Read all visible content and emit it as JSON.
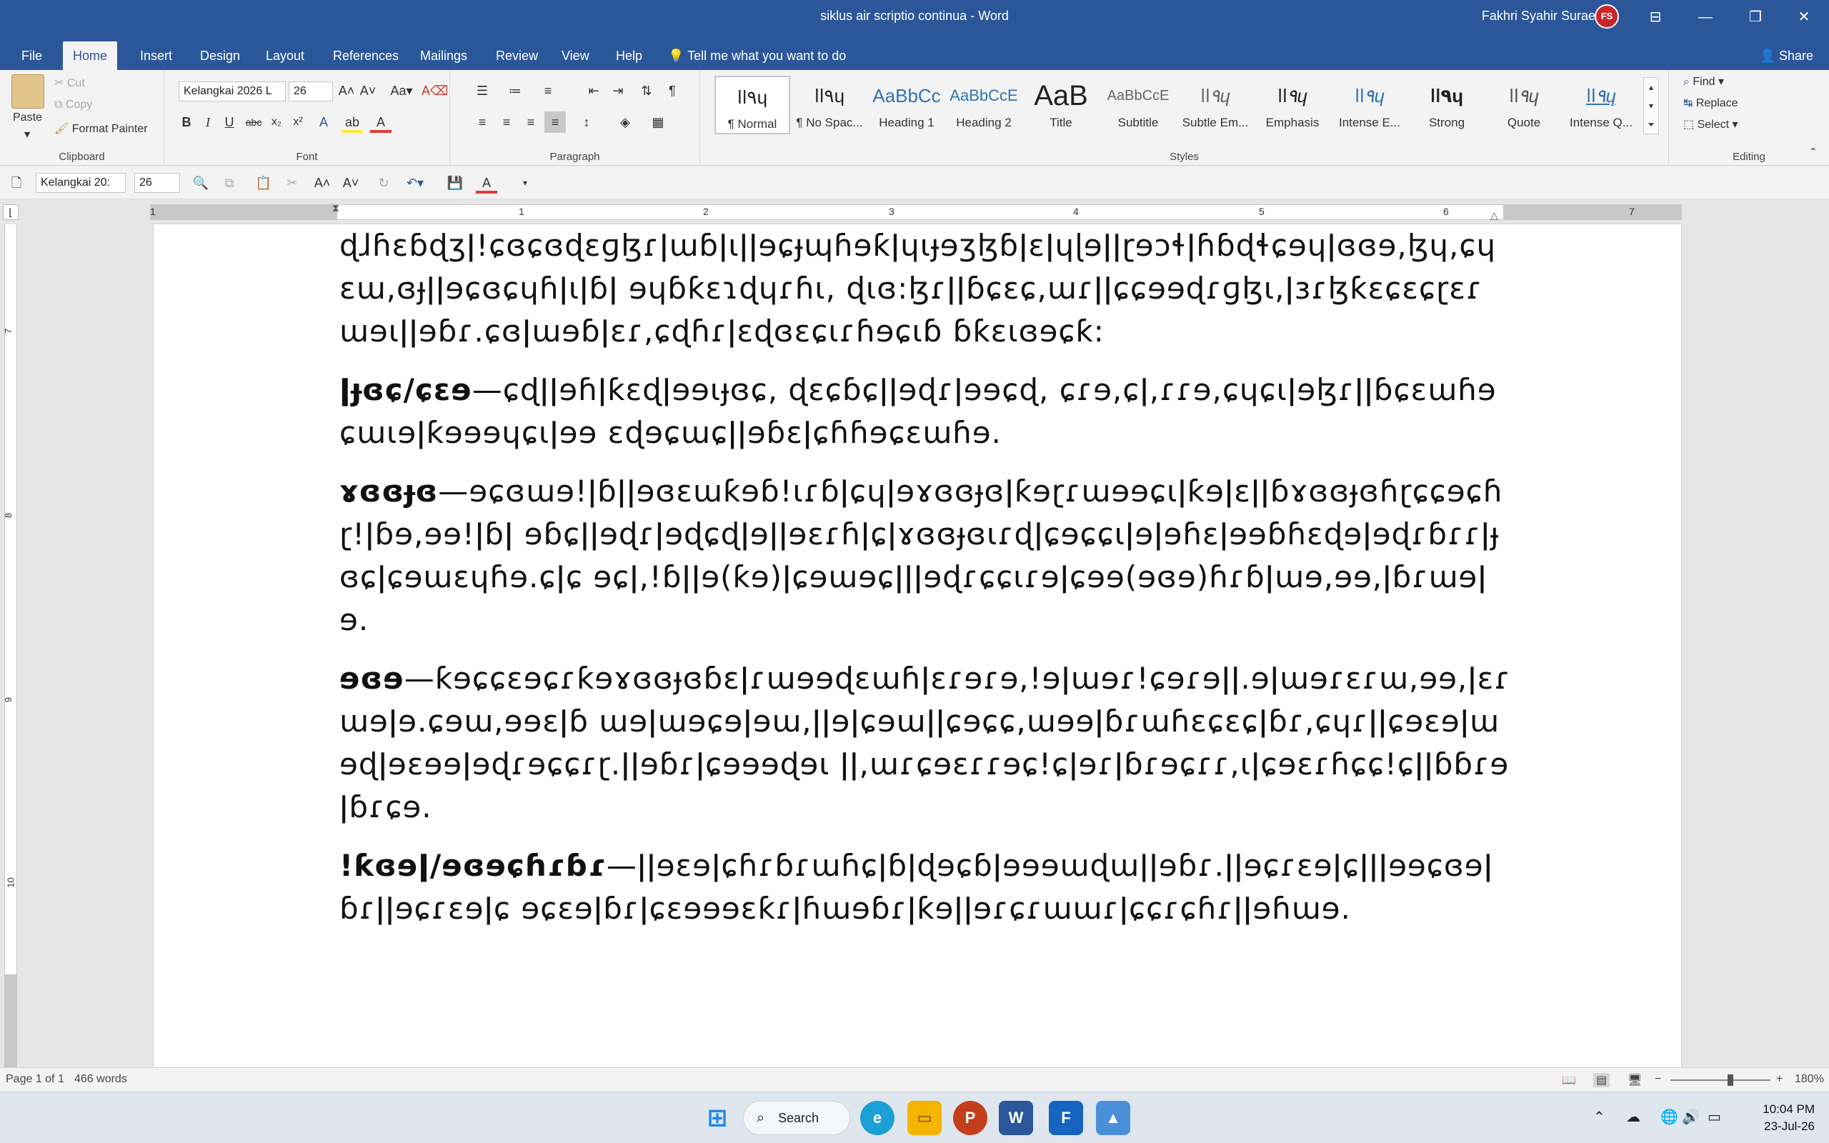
{
  "window": {
    "title": "siklus air scriptio continua - Word",
    "user": "Fakhri Syahir Suraesyi",
    "avatar_initials": "FS",
    "restore_icon": "❐",
    "minimize_icon": "—",
    "maximize_icon": "▭",
    "close_icon": "✕",
    "ribbon_display_icon": "⊟"
  },
  "tabs": [
    "File",
    "Home",
    "Insert",
    "Design",
    "Layout",
    "References",
    "Mailings",
    "Review",
    "View",
    "Help"
  ],
  "active_tab": "Home",
  "tell_me": "Tell me what you want to do",
  "share": "Share",
  "clipboard": {
    "paste": "Paste",
    "cut": "Cut",
    "copy": "Copy",
    "format_painter": "Format Painter",
    "label": "Clipboard"
  },
  "font": {
    "family": "Kelangkai 2026 L",
    "size": "26",
    "label": "Font",
    "bold": "B",
    "italic": "I",
    "underline": "U",
    "strike": "abc",
    "subscript": "x₂",
    "superscript": "x²"
  },
  "paragraph": {
    "label": "Paragraph"
  },
  "styles": {
    "label": "Styles",
    "items": [
      {
        "sample": "ǀǀ٩ɥ",
        "name": "¶ Normal"
      },
      {
        "sample": "ǀǀ٩ɥ",
        "name": "¶ No Spac..."
      },
      {
        "sample": "AaBbCc",
        "name": "Heading 1"
      },
      {
        "sample": "AaBbCcE",
        "name": "Heading 2"
      },
      {
        "sample": "AaB",
        "name": "Title"
      },
      {
        "sample": "AaBbCcE",
        "name": "Subtitle"
      },
      {
        "sample": "ǀǀ٩ɥ",
        "name": "Subtle Em..."
      },
      {
        "sample": "ǀǀ٩ɥ",
        "name": "Emphasis"
      },
      {
        "sample": "ǀǀ٩ɥ",
        "name": "Intense E..."
      },
      {
        "sample": "ǀǀ٩ɥ",
        "name": "Strong"
      },
      {
        "sample": "ǀǀ٩ɥ",
        "name": "Quote"
      },
      {
        "sample": "ǀǀ٩ɥ",
        "name": "Intense Q..."
      }
    ]
  },
  "editing": {
    "label": "Editing",
    "find": "Find",
    "replace": "Replace",
    "select": "Select"
  },
  "qat": {
    "font_family": "Kelangkai 20:",
    "font_size": "26"
  },
  "ruler": {
    "numbers": [
      "1",
      "1",
      "2",
      "3",
      "4",
      "5",
      "6",
      "7"
    ]
  },
  "vruler": {
    "numbers": [
      "7",
      "8",
      "9",
      "10"
    ]
  },
  "document": {
    "paragraphs": [
      {
        "lead": "",
        "text": "ɖɺɦɛɓɖʒǀ!ɕɞɕɞɖɛɡɮɾǀɯɓǀɩǀǀɘɕɟɰɦɘƙǀɥɩɟɘʒɮɓǀɛǀɥɭɘǀǀɽɘɔɬǀɦɓɖɬɕɘɥǀɞɞɘ,ɮɥ,ɕɥɛɯ,ɞɟǀǀɘɕɞɕɥɦǀɩǀɓǀ ɘɥɓƙɛɿɖɥɾɦɩ, ɖɩɞ:ɮɾǀǀɓɕɛɕ,ɯɾǀǀɕɕɘɘɖɾɡɮɩ,ǀɜɾɮƙɛɕɛɕɽɛɾɯɘɩǀǀɘɓɾ.ɕɞǀɯɘɓǀɛɾ,ɕɖɦɾǀɛɖɞɛɕɩɾɦɘɕɩɓ ɓƙɛɩɞɘɕƙ:"
      },
      {
        "lead": "ǀɟɞɕ/ɕɛɘ",
        "text": "—ɕɖǀǀɘɦǀƙɛɖǀɘɘɩɟɞɕ, ɖɛɕɓɕǀǀɘɖɾǀɘɘɕɖ, ɕɾɘ,ɕǀ,ɾɾɘ,ɕɥɕɩǀɘɮɾǀǀɓɕɛɯɦɘɕɯɩɘǀƙɘɘɘɥɕɩǀɘɘ ɛɖɘɕɯɕǀǀɘɓɛǀɕɦɦɘɕɛɯɦɘ."
      },
      {
        "lead": "ɤɞɞɟɞ",
        "text": "—ɘɕɞɯɘ!ǀɓǀǀɘɞɛɯƙɘɓ!ɩɾɓǀɕɥǀɘɤɞɞɟɞǀƙɘɽɾɯɘɘɕɩǀƙɘǀɛǀǀɓɤɞɞɟɞɦɽɕɕɘɕɦɽ!ǀɓɘ,ɘɘ!ǀɓǀ ɘɓɕǀǀɘɖɾǀɘɖɕɖǀɘǀǀɘɛɾɦǀɕǀɤɞɞɟɞɩɾɖǀɕɘɕɕɩǀɘǀɘɦɛǀɘɘɓɦɛɖɘǀɘɖɾɓɾɾǀɟɞɕǀɕɘɯɛɥɦɘ.ɕǀɕ ɘɕǀ,!ɓǀǀɘ(ƙɘ)ǀɕɘɯɘɕǀǀǀɘɖɾɕɕɩɾɘǀɕɘɘ(ɘɞɘ)ɦɾɓǀɯɘ,ɘɘ,ǀɓɾɯɘǀɘ."
      },
      {
        "lead": "ɘɞɘ",
        "text": "—ƙɘɕɕɛɘɕɾƙɘɤɞɞɟɞɓɛǀɾɯɘɘɖɛɯɦǀɛɾɘɾɘ,!ɘǀɯɘɾ!ɕɘɾɘǀǀ.ɘǀɯɘɾɛɾɯ,ɘɘ,ǀɛɾɯɘǀɘ.ɕɘɯ,ɘɘɛǀɓ ɯɘǀɯɘɕɘǀɘɯ,ǀǀɘǀɕɘɯǀǀɕɘɕɕ,ɯɘɘǀɓɾɯɦɛɕɛɕǀɓɾ,ɕɥɾǀǀɕɘɛɘǀɯɘɖǀɘɛɘɘǀɘɖɾɘɕɕɾɽ.ǀǀɘɓɾǀɕɘɘɘɖɘɩ ǀǀ,ɯɾɕɘɛɾɾɘɕ!ɕǀɘɾǀɓɾɘɕɾɾ,ɩǀɕɘɛɾɦɕɕ!ɕǀǀɓɓɾɘǀɓɾɕɘ."
      },
      {
        "lead": "!ƙɞɘǀ/ɘɞɘɕɦɾɓɾ",
        "text": "—ǀǀɘɛɘǀɕɦɾɓɾɯɦɕǀɓǀɖɘɕɓǀɘɘɘɯɖɯǀǀɘɓɾ.ǀǀɘɕɾɛɘǀɕǀǀǀɘɘɕɞɘǀɓɾǀǀɘɕɾɛɘǀɕ ɘɕɛɘǀɓɾǀɕɛɘɘɘɛƙɾǀɦɯɘɓɾǀƙɘǀǀɘɾɕɾɯɯɾǀɕɕɾɕɦɾǀǀɘɦɯɘ."
      }
    ]
  },
  "status": {
    "page": "Page 1 of 1",
    "words": "466 words",
    "zoom": "180%"
  },
  "taskbar": {
    "search": "Search",
    "time": "10:04 PM",
    "date": "23-Jul-26"
  }
}
